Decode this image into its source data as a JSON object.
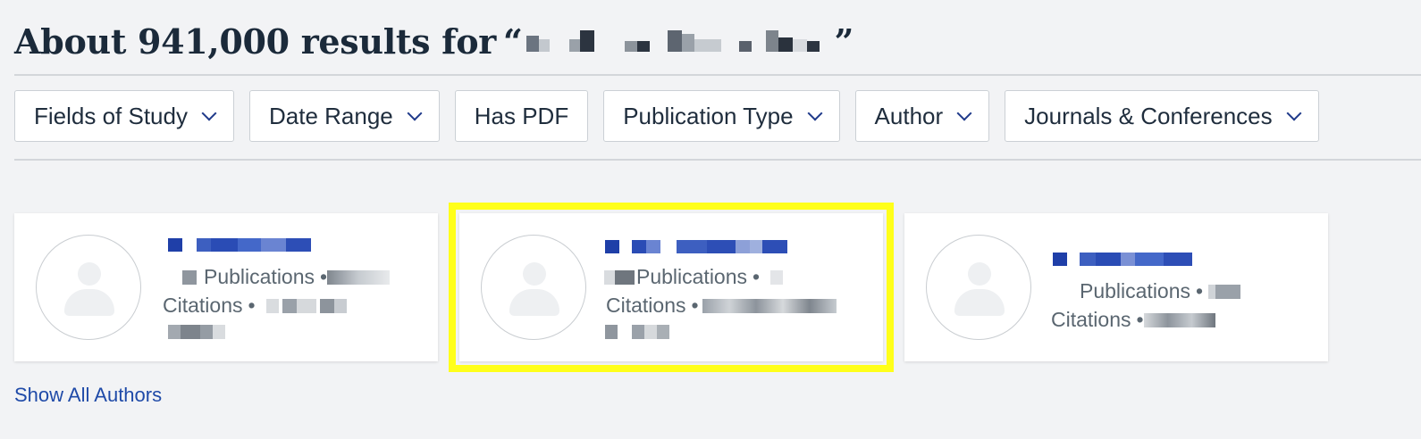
{
  "search": {
    "results_prefix": "About 941,000 results for",
    "open_quote": "“",
    "close_quote": "”"
  },
  "filters": [
    {
      "label": "Fields of Study",
      "dropdown": true
    },
    {
      "label": "Date Range",
      "dropdown": true
    },
    {
      "label": "Has PDF",
      "dropdown": false
    },
    {
      "label": "Publication Type",
      "dropdown": true
    },
    {
      "label": "Author",
      "dropdown": true
    },
    {
      "label": "Journals & Conferences",
      "dropdown": true
    }
  ],
  "authors": {
    "cards": [
      {
        "name": "",
        "publications_label": "Publications",
        "citations_label": "Citations",
        "separator": "•",
        "highlighted": false
      },
      {
        "name": "",
        "publications_label": "Publications",
        "citations_label": "Citations",
        "separator": "•",
        "highlighted": true
      },
      {
        "name": "",
        "publications_label": "Publications",
        "citations_label": "Citations",
        "separator": "•",
        "highlighted": false
      }
    ],
    "show_all_label": "Show All Authors"
  },
  "colors": {
    "background": "#f2f3f5",
    "link": "#1f4aa8",
    "highlight": "#ffff1a",
    "name_blue": "#1f3fa8"
  },
  "icons": [
    "chevron-down-icon",
    "user-avatar-icon"
  ]
}
